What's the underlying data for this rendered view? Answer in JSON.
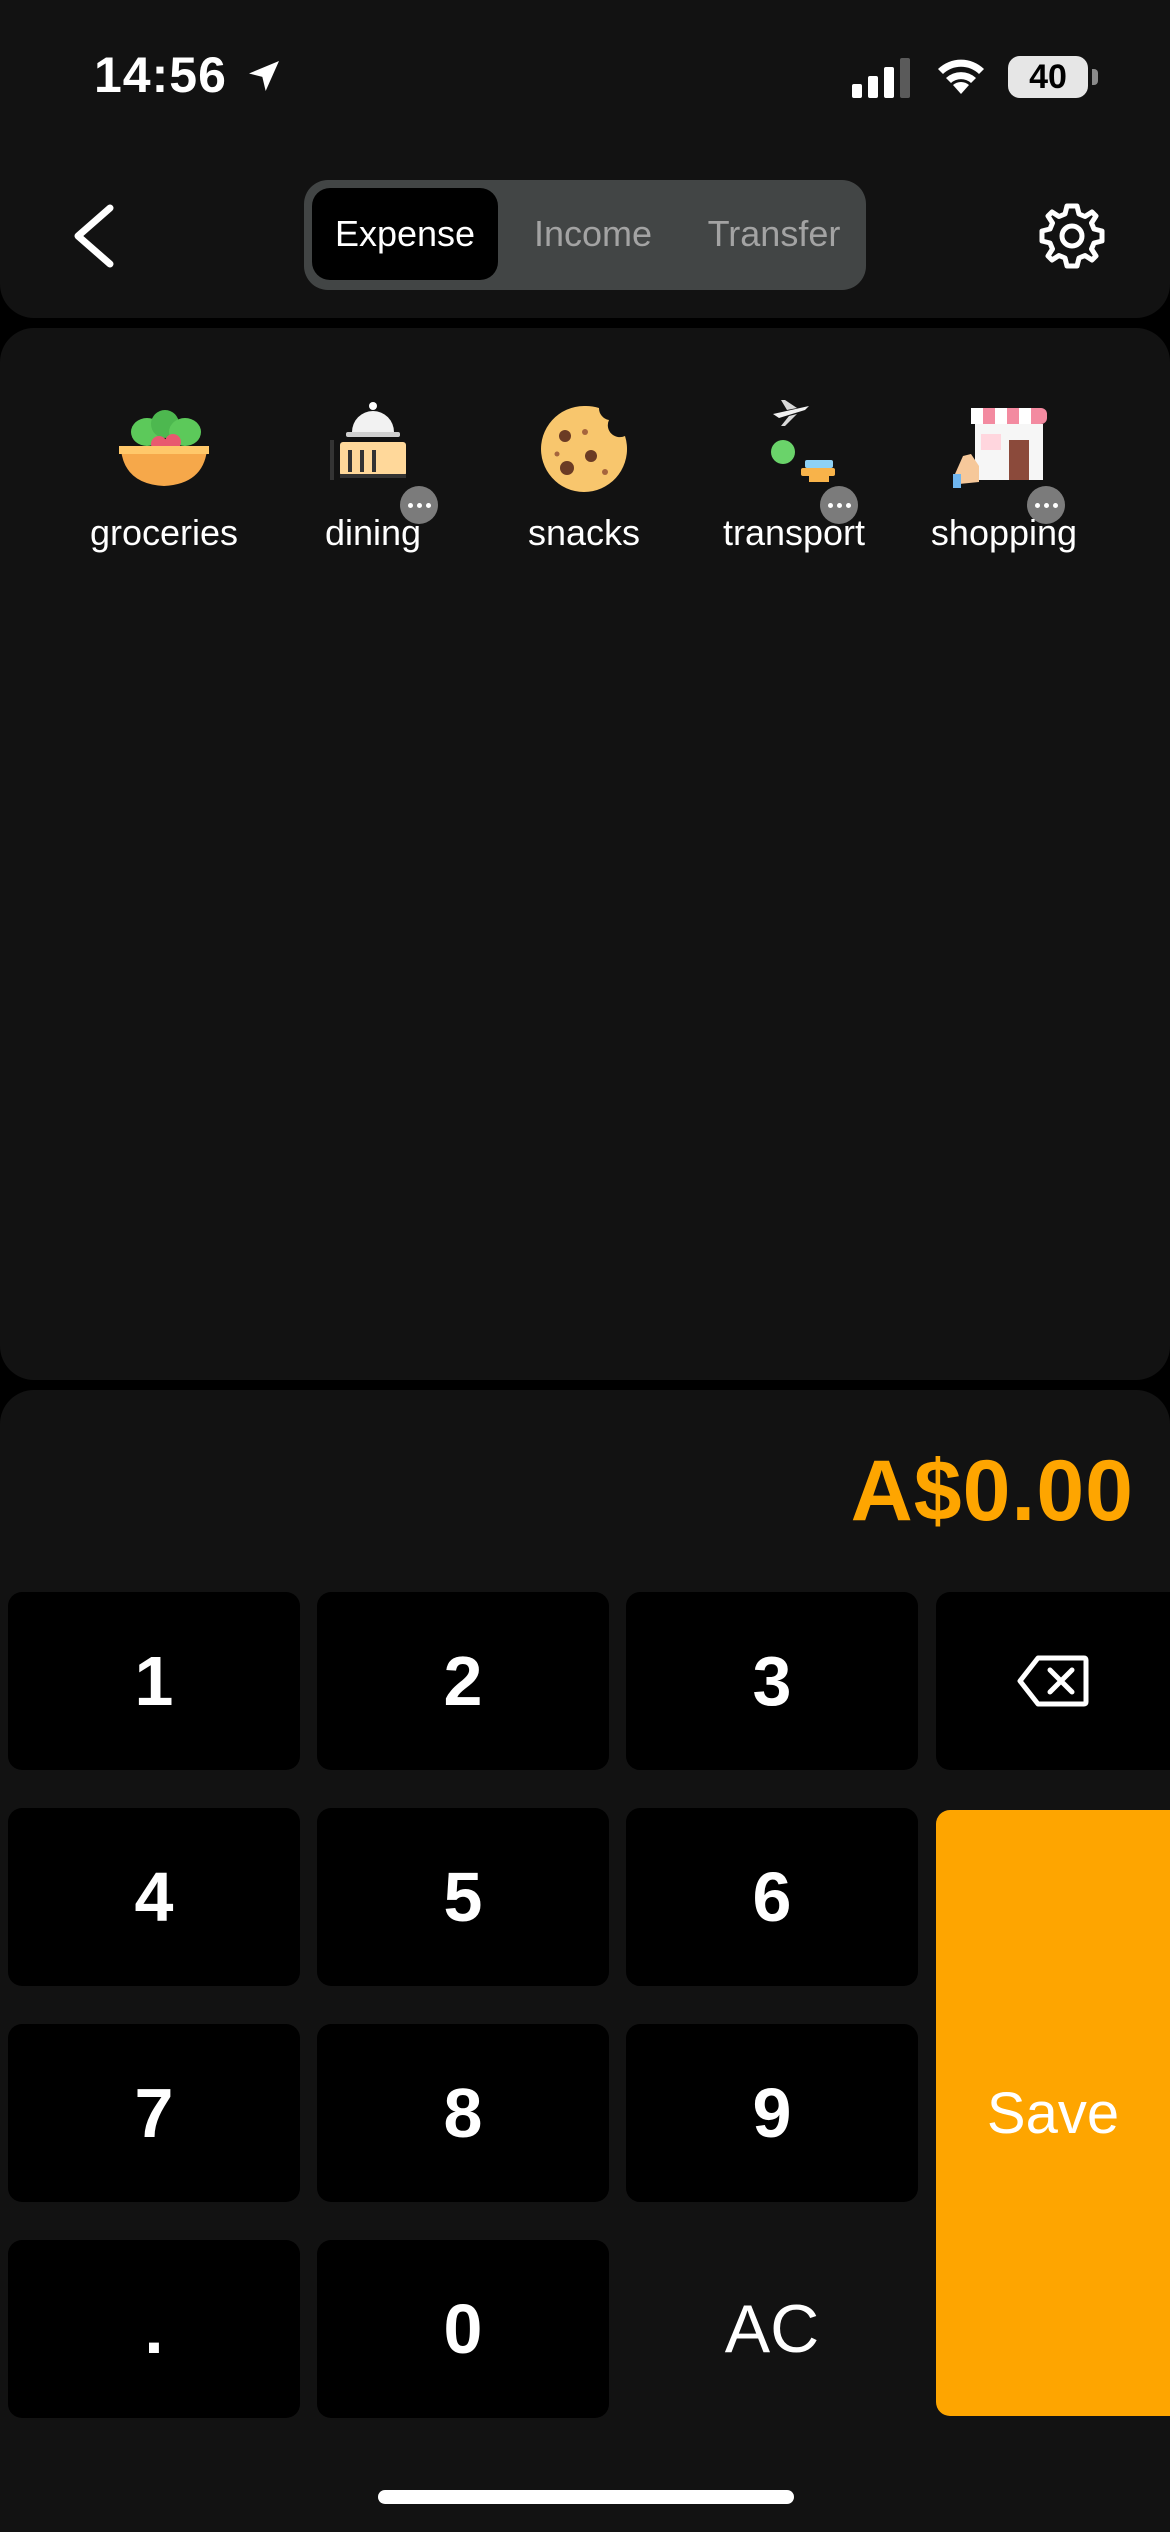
{
  "status_bar": {
    "time": "14:56",
    "battery": "40",
    "icons": [
      "location-arrow-icon",
      "cellular-signal-icon",
      "wifi-icon",
      "battery-icon"
    ]
  },
  "header": {
    "back_icon": "chevron-left-icon",
    "settings_icon": "gear-icon",
    "tabs": [
      {
        "label": "Expense",
        "active": true
      },
      {
        "label": "Income",
        "active": false
      },
      {
        "label": "Transfer",
        "active": false
      }
    ]
  },
  "categories": [
    {
      "label": "groceries",
      "icon": "salad-bowl-icon",
      "has_more": false
    },
    {
      "label": "dining",
      "icon": "dining-cloche-icon",
      "has_more": true
    },
    {
      "label": "snacks",
      "icon": "cookie-icon",
      "has_more": false
    },
    {
      "label": "transport",
      "icon": "airplane-transport-icon",
      "has_more": true
    },
    {
      "label": "shopping",
      "icon": "storefront-icon",
      "has_more": true
    }
  ],
  "amount": "A$0.00",
  "keypad": {
    "k1": "1",
    "k2": "2",
    "k3": "3",
    "k4": "4",
    "k5": "5",
    "k6": "6",
    "k7": "7",
    "k8": "8",
    "k9": "9",
    "dot": ".",
    "k0": "0",
    "clear": "AC",
    "save": "Save",
    "backspace_icon": "backspace-icon"
  },
  "colors": {
    "accent": "#fea500",
    "background": "#000000",
    "panel": "#121212",
    "segment_bg": "#424545"
  }
}
